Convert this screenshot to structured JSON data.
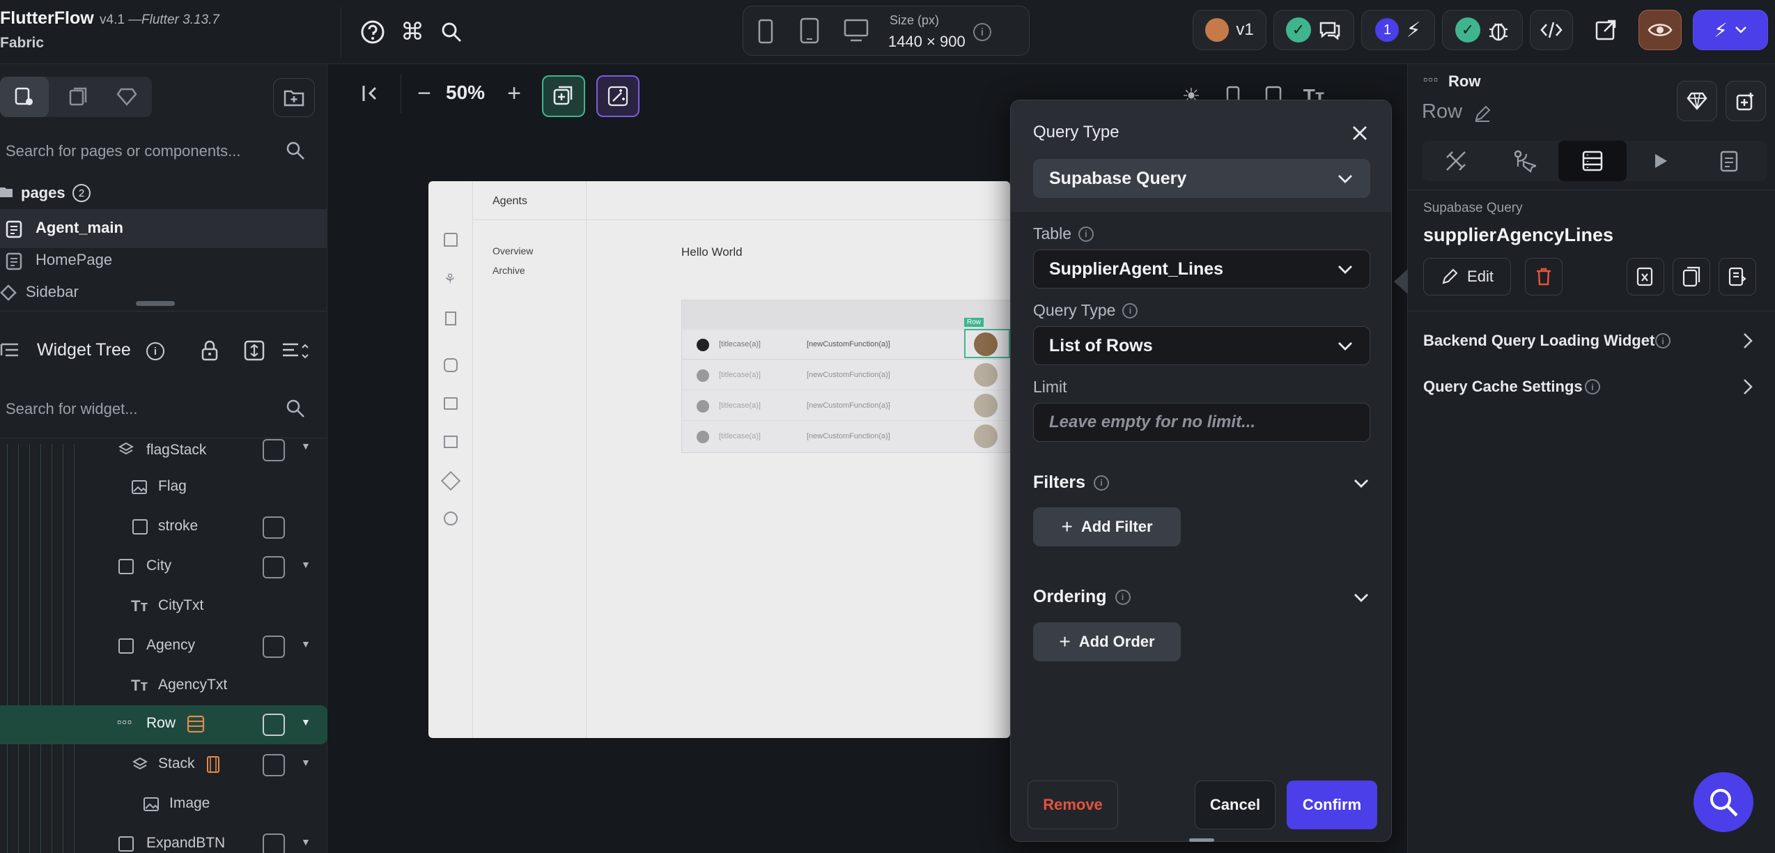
{
  "topbar": {
    "app_name": "FlutterFlow",
    "version": "v4.1 —",
    "flutter_version": "Flutter 3.13.7",
    "project": "Fabric",
    "size_label": "Size (px)",
    "size_value": "1440 × 900",
    "version_badge": "v1",
    "notif_count": "1"
  },
  "left": {
    "search_pages_placeholder": "Search for pages or components...",
    "pages_label": "pages",
    "pages_count": "2",
    "pages": [
      "Agent_main",
      "HomePage",
      "Sidebar"
    ],
    "widget_tree_label": "Widget Tree",
    "search_widget_placeholder": "Search for widget...",
    "tree": [
      "flagStack",
      "Flag",
      "stroke",
      "City",
      "CityTxt",
      "Agency",
      "AgencyTxt",
      "Row",
      "Stack",
      "Image",
      "ExpandBTN"
    ]
  },
  "canvas": {
    "zoom": "50%",
    "preview": {
      "header": "Agents",
      "nav": [
        "Overview",
        "Archive"
      ],
      "title": "Hello World",
      "row_tag": "Row",
      "cell_a": "[titlecase(a)]",
      "cell_b": "[newCustomFunction(a)]"
    }
  },
  "modal": {
    "title": "Query Type",
    "query_source": "Supabase Query",
    "table_label": "Table",
    "table_value": "SupplierAgent_Lines",
    "qtype_label": "Query Type",
    "qtype_value": "List of Rows",
    "limit_label": "Limit",
    "limit_placeholder": "Leave empty for no limit...",
    "filters_label": "Filters",
    "add_filter": "Add Filter",
    "ordering_label": "Ordering",
    "add_order": "Add Order",
    "remove": "Remove",
    "cancel": "Cancel",
    "confirm": "Confirm"
  },
  "right": {
    "widget_type": "Row",
    "widget_name": "Row",
    "query_kind": "Supabase Query",
    "query_name": "supplierAgencyLines",
    "edit": "Edit",
    "loading_widget": "Backend Query Loading Widget",
    "cache_settings": "Query Cache Settings"
  },
  "colors": {
    "accent": "#5b4fe0",
    "confirm": "#4a3fe8",
    "remove": "#e5533d",
    "green": "#3fb58f"
  }
}
